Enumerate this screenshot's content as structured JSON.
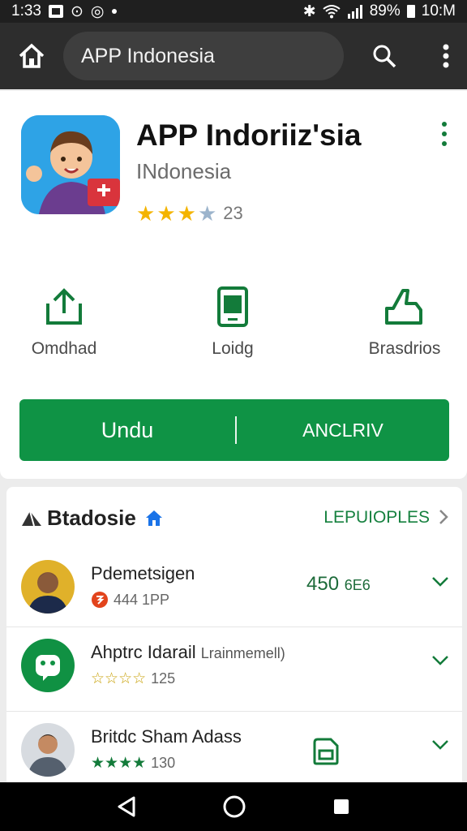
{
  "status_bar": {
    "time": "1:33",
    "battery": "89%",
    "clock": "10:M"
  },
  "toolbar": {
    "search_text": "APP Indonesia"
  },
  "app": {
    "title": "APP Indoriiz'sia",
    "developer": "INdonesia",
    "rating_count": "23",
    "rating_stars": 3.5,
    "actions": [
      {
        "label": "Omdhad",
        "icon": "share-icon"
      },
      {
        "label": "Loidg",
        "icon": "phone-icon"
      },
      {
        "label": "Brasdrios",
        "icon": "thumbs-up-icon"
      }
    ],
    "install": {
      "main_label": "Undu",
      "side_label": "ANCLRIV"
    }
  },
  "list": {
    "title": "Btadosie",
    "more_label": "LEPUIOPLES",
    "items": [
      {
        "name": "Pdemetsigen",
        "sub": "444 1PP",
        "meta_value": "450",
        "meta_unit": "6E6"
      },
      {
        "name": "Ahptrc Idarail",
        "name_extra": "Lrainmemell)",
        "sub": "125"
      },
      {
        "name": "Britdc Sham Adass",
        "sub": "130"
      }
    ]
  },
  "colors": {
    "accent_green": "#0f9345",
    "toolbar": "#2d2d2d",
    "star": "#f4b400",
    "star_empty": "#9cb4cc"
  }
}
